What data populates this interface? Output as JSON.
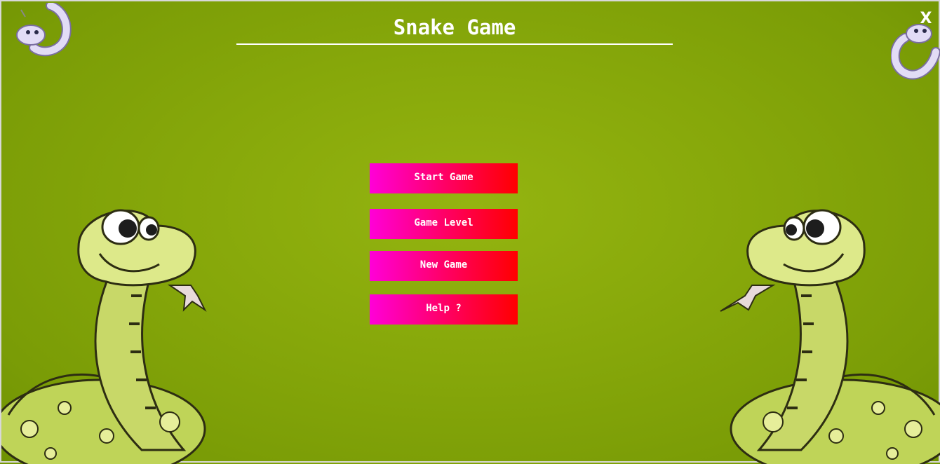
{
  "app": {
    "title": "Snake Game",
    "close_label": "X"
  },
  "menu": {
    "items": [
      {
        "id": "start",
        "label": "Start Game"
      },
      {
        "id": "level",
        "label": "Game Level"
      },
      {
        "id": "new",
        "label": "New Game"
      },
      {
        "id": "help",
        "label": "Help ?"
      }
    ]
  },
  "colors": {
    "background": "#86a70a",
    "button_gradient_start": "#ff00d8",
    "button_gradient_end": "#ff0000",
    "snake_body": "#c8d868",
    "corner_snake": "#d8d0f0"
  },
  "icons": [
    "corner-snake-icon-left",
    "corner-snake-icon-right",
    "cartoon-snake-left",
    "cartoon-snake-right"
  ]
}
